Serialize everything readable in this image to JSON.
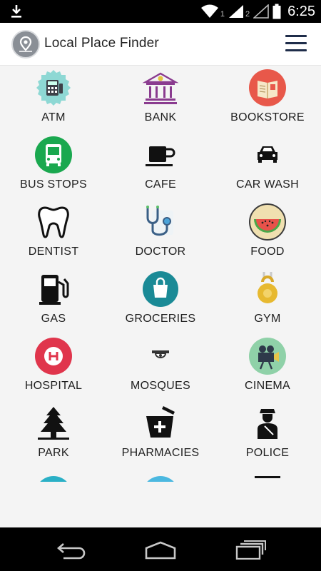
{
  "status_bar": {
    "time": "6:25",
    "sim1": "1",
    "sim2": "2",
    "icons": [
      "download-icon",
      "wifi-icon",
      "signal-icon",
      "signal-empty-icon",
      "battery-icon"
    ]
  },
  "app_bar": {
    "title": "Local Place Finder",
    "logo_icon": "map-pin-icon",
    "menu_icon": "hamburger-menu-icon"
  },
  "categories": [
    {
      "label": "ATM",
      "icon": "atm-icon"
    },
    {
      "label": "BANK",
      "icon": "bank-icon"
    },
    {
      "label": "BOOKSTORE",
      "icon": "book-icon"
    },
    {
      "label": "BUS STOPS",
      "icon": "bus-icon"
    },
    {
      "label": "CAFE",
      "icon": "coffee-cup-icon"
    },
    {
      "label": "CAR WASH",
      "icon": "car-icon"
    },
    {
      "label": "DENTIST",
      "icon": "tooth-icon"
    },
    {
      "label": "DOCTOR",
      "icon": "stethoscope-icon"
    },
    {
      "label": "FOOD",
      "icon": "watermelon-icon"
    },
    {
      "label": "GAS",
      "icon": "fuel-pump-icon"
    },
    {
      "label": "GROCERIES",
      "icon": "shopping-bag-icon"
    },
    {
      "label": "GYM",
      "icon": "kettlebell-icon"
    },
    {
      "label": "HOSPITAL",
      "icon": "hospital-icon"
    },
    {
      "label": "MOSQUES",
      "icon": "mosque-icon"
    },
    {
      "label": "CINEMA",
      "icon": "movie-camera-icon"
    },
    {
      "label": "PARK",
      "icon": "tree-icon"
    },
    {
      "label": "PHARMACIES",
      "icon": "pharmacy-icon"
    },
    {
      "label": "POLICE",
      "icon": "police-officer-icon"
    }
  ],
  "colors": {
    "menu": "#1f2d4a",
    "bus_green": "#1aa84f",
    "hospital_red": "#e0354c",
    "groceries_teal": "#1a8a96",
    "bookstore_red": "#e8584a",
    "atm_teal": "#7fd0cf"
  },
  "nav_bar": {
    "icons": [
      "back-icon",
      "home-icon",
      "recent-apps-icon"
    ]
  }
}
